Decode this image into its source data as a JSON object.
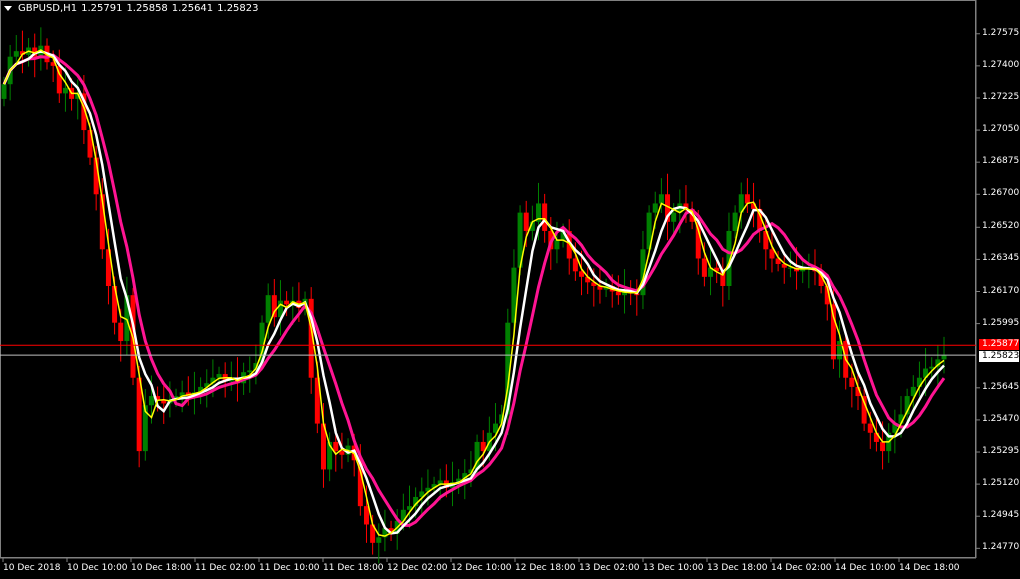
{
  "header": {
    "symbol": "GBPUSD,H1",
    "open": "1.25791",
    "high": "1.25858",
    "low": "1.25641",
    "close": "1.25823"
  },
  "colors": {
    "background": "#000000",
    "bull_candle": "#008000",
    "bear_candle": "#ff0000",
    "ma_fast": "#ffff00",
    "ma_mid": "#ffffff",
    "ma_slow": "#ff1493",
    "ask_line": "#ff0000",
    "bid_line": "#c0c0c0"
  },
  "price_axis": {
    "labels": [
      "1.27575",
      "1.27400",
      "1.27225",
      "1.27050",
      "1.26875",
      "1.26700",
      "1.26520",
      "1.26345",
      "1.26170",
      "1.25995",
      "1.25645",
      "1.25470",
      "1.25295",
      "1.25120",
      "1.24945",
      "1.24770"
    ],
    "ask_tag": "1.25877",
    "bid_tag": "1.25823"
  },
  "time_axis": {
    "labels": [
      "10 Dec 2018",
      "10 Dec 10:00",
      "10 Dec 18:00",
      "11 Dec 02:00",
      "11 Dec 10:00",
      "11 Dec 18:00",
      "12 Dec 02:00",
      "12 Dec 10:00",
      "12 Dec 18:00",
      "13 Dec 02:00",
      "13 Dec 10:00",
      "13 Dec 18:00",
      "14 Dec 02:00",
      "14 Dec 10:00",
      "14 Dec 18:00"
    ]
  },
  "chart_data": {
    "type": "candlestick",
    "ylim": [
      1.2475,
      1.2765
    ],
    "ask": 1.25877,
    "bid": 1.25823,
    "closes": [
      1.273,
      1.2745,
      1.2748,
      1.2746,
      1.275,
      1.2745,
      1.2751,
      1.2742,
      1.274,
      1.2725,
      1.2728,
      1.2722,
      1.2725,
      1.2705,
      1.269,
      1.267,
      1.264,
      1.262,
      1.26,
      1.259,
      1.2615,
      1.257,
      1.253,
      1.2555,
      1.256,
      1.2558,
      1.2556,
      1.2558,
      1.256,
      1.2562,
      1.256,
      1.2562,
      1.2565,
      1.2567,
      1.257,
      1.2572,
      1.2568,
      1.257,
      1.2567,
      1.2573,
      1.2574,
      1.2578,
      1.26,
      1.2615,
      1.2603,
      1.2612,
      1.261,
      1.2612,
      1.2608,
      1.2613,
      1.257,
      1.2545,
      1.252,
      1.2535,
      1.253,
      1.2528,
      1.2533,
      1.2525,
      1.25,
      1.249,
      1.248,
      1.2483,
      1.2488,
      1.2485,
      1.2492,
      1.2498,
      1.25,
      1.2505,
      1.2508,
      1.251,
      1.2512,
      1.2514,
      1.251,
      1.2513,
      1.2515,
      1.2518,
      1.252,
      1.2535,
      1.253,
      1.254,
      1.2545,
      1.255,
      1.26,
      1.263,
      1.266,
      1.265,
      1.2655,
      1.2665,
      1.265,
      1.264,
      1.2645,
      1.265,
      1.2635,
      1.2628,
      1.2625,
      1.2622,
      1.262,
      1.2618,
      1.262,
      1.2617,
      1.2615,
      1.2618,
      1.2616,
      1.2615,
      1.264,
      1.266,
      1.2665,
      1.267,
      1.2655,
      1.266,
      1.2665,
      1.2662,
      1.2655,
      1.2635,
      1.2625,
      1.263,
      1.2628,
      1.262,
      1.265,
      1.266,
      1.267,
      1.2665,
      1.2662,
      1.265,
      1.264,
      1.2635,
      1.2632,
      1.263,
      1.263,
      1.2628,
      1.263,
      1.263,
      1.2628,
      1.262,
      1.261,
      1.258,
      1.259,
      1.257,
      1.2565,
      1.256,
      1.2545,
      1.254,
      1.2535,
      1.253,
      1.254,
      1.2545,
      1.255,
      1.256,
      1.2565,
      1.257,
      1.2575,
      1.2576,
      1.258,
      1.25823
    ]
  }
}
